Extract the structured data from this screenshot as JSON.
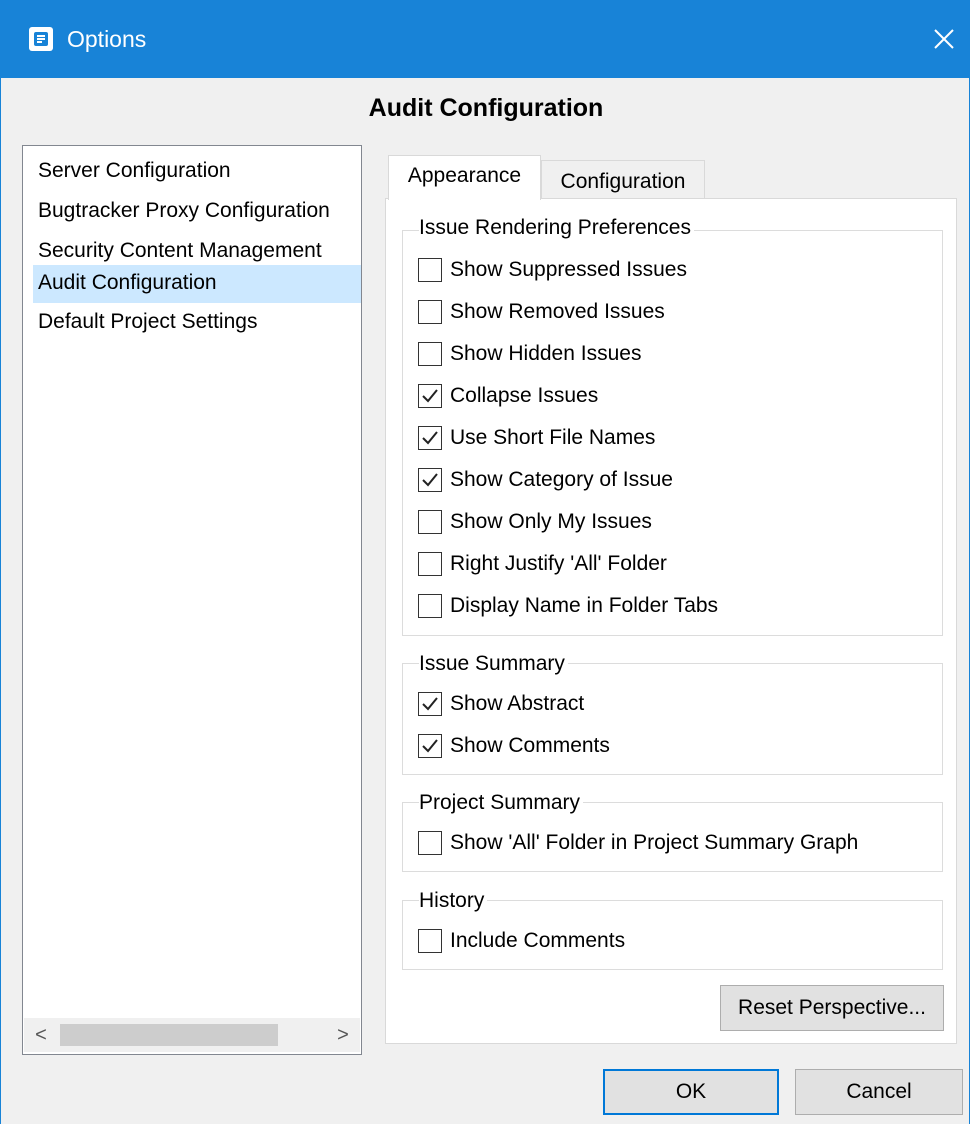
{
  "window": {
    "title": "Options",
    "accent": "#1883d7",
    "icon": "app-icon",
    "close_icon": "close-icon"
  },
  "heading": "Audit Configuration",
  "nav": {
    "items": [
      {
        "label": "Server Configuration",
        "selected": false
      },
      {
        "label": "Bugtracker Proxy Configuration",
        "selected": false
      },
      {
        "label": "Security Content Management",
        "selected": false
      },
      {
        "label": "Audit Configuration",
        "selected": true
      },
      {
        "label": "Default Project Settings",
        "selected": false
      }
    ],
    "scroll_left": "<",
    "scroll_right": ">"
  },
  "tabs": [
    {
      "label": "Appearance",
      "active": true
    },
    {
      "label": "Configuration",
      "active": false
    }
  ],
  "groups": {
    "rendering": {
      "title": "Issue Rendering Preferences",
      "options": [
        {
          "label": "Show Suppressed Issues",
          "checked": false
        },
        {
          "label": "Show Removed Issues",
          "checked": false
        },
        {
          "label": "Show Hidden Issues",
          "checked": false
        },
        {
          "label": "Collapse Issues",
          "checked": true
        },
        {
          "label": "Use Short File Names",
          "checked": true
        },
        {
          "label": "Show Category of Issue",
          "checked": true
        },
        {
          "label": "Show Only My Issues",
          "checked": false
        },
        {
          "label": "Right Justify 'All' Folder",
          "checked": false
        },
        {
          "label": "Display Name in Folder Tabs",
          "checked": false
        }
      ]
    },
    "summary": {
      "title": "Issue Summary",
      "options": [
        {
          "label": "Show Abstract",
          "checked": true
        },
        {
          "label": "Show Comments",
          "checked": true
        }
      ]
    },
    "project": {
      "title": "Project Summary",
      "options": [
        {
          "label": "Show 'All' Folder in Project Summary Graph",
          "checked": false
        }
      ]
    },
    "history": {
      "title": "History",
      "options": [
        {
          "label": "Include Comments",
          "checked": false
        }
      ]
    }
  },
  "buttons": {
    "reset": "Reset Perspective...",
    "ok": "OK",
    "cancel": "Cancel"
  }
}
